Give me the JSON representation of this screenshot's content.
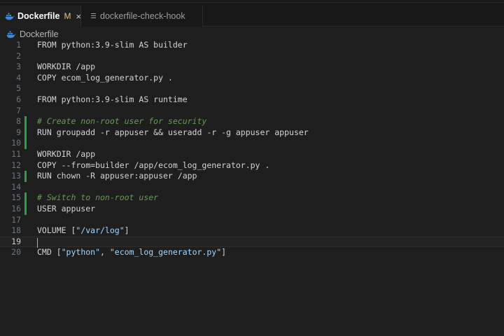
{
  "tabs": [
    {
      "label": "Dockerfile",
      "modified": "M",
      "close": "×",
      "icon": "docker-whale-icon",
      "active": true
    },
    {
      "label": "dockerfile-check-hook",
      "icon": "file-lines-icon",
      "active": false
    }
  ],
  "breadcrumb": {
    "label": "Dockerfile",
    "icon": "docker-whale-icon"
  },
  "editor": {
    "current_line": 19,
    "modified_line_ranges": [
      [
        8,
        10
      ],
      [
        13,
        13
      ],
      [
        15,
        16
      ]
    ],
    "lines": [
      {
        "n": "1",
        "segments": [
          {
            "t": "FROM python:3.9-slim AS builder",
            "c": "plain"
          }
        ]
      },
      {
        "n": "2",
        "segments": []
      },
      {
        "n": "3",
        "segments": [
          {
            "t": "WORKDIR /app",
            "c": "plain"
          }
        ]
      },
      {
        "n": "4",
        "segments": [
          {
            "t": "COPY ecom_log_generator.py .",
            "c": "plain"
          }
        ]
      },
      {
        "n": "5",
        "segments": []
      },
      {
        "n": "6",
        "segments": [
          {
            "t": "FROM python:3.9-slim AS runtime",
            "c": "plain"
          }
        ]
      },
      {
        "n": "7",
        "segments": []
      },
      {
        "n": "8",
        "segments": [
          {
            "t": "# Create non-root user for security",
            "c": "comment"
          }
        ]
      },
      {
        "n": "9",
        "segments": [
          {
            "t": "RUN groupadd -r appuser && useradd -r -g appuser appuser",
            "c": "plain"
          }
        ]
      },
      {
        "n": "10",
        "segments": []
      },
      {
        "n": "11",
        "segments": [
          {
            "t": "WORKDIR /app",
            "c": "plain"
          }
        ]
      },
      {
        "n": "12",
        "segments": [
          {
            "t": "COPY --from=builder /app/ecom_log_generator.py .",
            "c": "plain"
          }
        ]
      },
      {
        "n": "13",
        "segments": [
          {
            "t": "RUN chown -R appuser:appuser /app",
            "c": "plain"
          }
        ]
      },
      {
        "n": "14",
        "segments": []
      },
      {
        "n": "15",
        "segments": [
          {
            "t": "# Switch to non-root user",
            "c": "comment"
          }
        ]
      },
      {
        "n": "16",
        "segments": [
          {
            "t": "USER appuser",
            "c": "plain"
          }
        ]
      },
      {
        "n": "17",
        "segments": []
      },
      {
        "n": "18",
        "segments": [
          {
            "t": "VOLUME [",
            "c": "plain"
          },
          {
            "t": "\"/var/log\"",
            "c": "str"
          },
          {
            "t": "]",
            "c": "plain"
          }
        ]
      },
      {
        "n": "19",
        "segments": []
      },
      {
        "n": "20",
        "segments": [
          {
            "t": "CMD [",
            "c": "plain"
          },
          {
            "t": "\"python\"",
            "c": "str"
          },
          {
            "t": ", ",
            "c": "plain"
          },
          {
            "t": "\"ecom_log_generator.py\"",
            "c": "str"
          },
          {
            "t": "]",
            "c": "plain"
          }
        ]
      }
    ]
  },
  "colors": {
    "background": "#1e1e1e",
    "tabbar": "#181818",
    "comment": "#6a9955",
    "string": "#a5d6ff",
    "modified_marker": "#e2c08d",
    "gutter_added": "#2ea043",
    "docker_blue": "#3d8ad8"
  }
}
